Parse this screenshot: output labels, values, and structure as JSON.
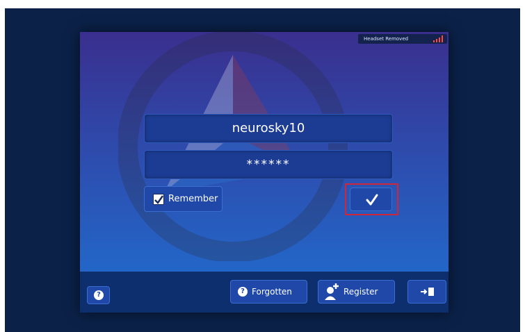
{
  "status": {
    "headset_text": "Headset Removed"
  },
  "login": {
    "username_value": "neurosky10",
    "password_value": "******"
  },
  "remember": {
    "label": "Remember",
    "checked": true
  },
  "footer": {
    "forgotten_label": "Forgotten",
    "register_label": "Register"
  },
  "icons": {
    "help": "question-mark-icon",
    "submit": "checkmark-icon",
    "register": "add-user-icon",
    "exit": "exit-door-icon",
    "signal": "signal-bars-icon"
  },
  "colors": {
    "panel_top": "#3a2f8e",
    "panel_bottom": "#1f6fd1",
    "button_fill": "#1f48a8",
    "highlight_border": "#d0263a",
    "signal_color": "#ff4a3d"
  }
}
